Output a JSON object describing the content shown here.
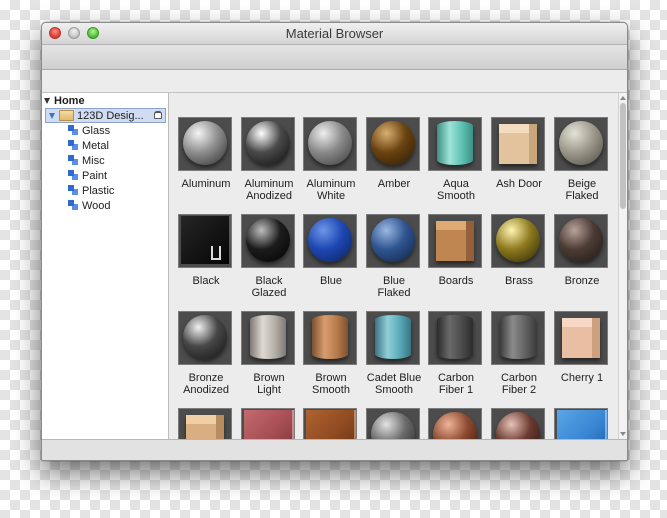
{
  "window": {
    "title": "Material Browser"
  },
  "tree": {
    "home_label": "Home",
    "library_label": "123D Desig...",
    "categories": [
      "Glass",
      "Metal",
      "Misc",
      "Paint",
      "Plastic",
      "Wood"
    ]
  },
  "materials": [
    {
      "label": "Aluminum",
      "shape": "sphere",
      "colors": [
        "#f4f4f4",
        "#8f8f8f",
        "#2e2e2e"
      ]
    },
    {
      "label": "Aluminum\nAnodized",
      "shape": "sphere",
      "colors": [
        "#ffffff",
        "#4a4a4a",
        "#0c0c0c"
      ]
    },
    {
      "label": "Aluminum\nWhite",
      "shape": "sphere",
      "colors": [
        "#eeeeee",
        "#8a8a8a",
        "#3a3a3a"
      ]
    },
    {
      "label": "Amber",
      "shape": "sphere",
      "colors": [
        "#d9b070",
        "#6b4310",
        "#2a1a06"
      ]
    },
    {
      "label": "Aqua\nSmooth",
      "shape": "cylinder",
      "colors": [
        "#9fe3d8",
        "#5cc2b4",
        "#3b8f84"
      ]
    },
    {
      "label": "Ash Door",
      "shape": "cube",
      "colors": [
        "#f4dcbf",
        "#e2c39d",
        "#c9a57a"
      ]
    },
    {
      "label": "Beige\nFlaked",
      "shape": "sphere",
      "colors": [
        "#e5e2d8",
        "#9e998c",
        "#4e4a42"
      ]
    },
    {
      "label": "Black",
      "shape": "chair",
      "colors": [
        "#252525",
        "#141414",
        "#050505"
      ]
    },
    {
      "label": "Black\nGlazed",
      "shape": "sphere",
      "colors": [
        "#bdbdbd",
        "#1c1c1c",
        "#020202"
      ]
    },
    {
      "label": "Blue",
      "shape": "sphere",
      "colors": [
        "#6f96e8",
        "#1d48b3",
        "#0a1f5c"
      ]
    },
    {
      "label": "Blue\nFlaked",
      "shape": "sphere",
      "colors": [
        "#9ab8e2",
        "#2f5591",
        "#0e2142"
      ]
    },
    {
      "label": "Boards",
      "shape": "cube",
      "colors": [
        "#deaa74",
        "#c08651",
        "#93603a"
      ]
    },
    {
      "label": "Brass",
      "shape": "sphere",
      "colors": [
        "#fff4b0",
        "#8d7a1f",
        "#2b2406"
      ]
    },
    {
      "label": "Bronze",
      "shape": "sphere",
      "colors": [
        "#b7a39a",
        "#4c3c35",
        "#1e1613"
      ]
    },
    {
      "label": "Bronze\nAnodized",
      "shape": "sphere",
      "colors": [
        "#f2f2f2",
        "#474747",
        "#121212"
      ]
    },
    {
      "label": "Brown\nLight",
      "shape": "cylinder",
      "colors": [
        "#dedad3",
        "#b3afa7",
        "#7e7a73"
      ]
    },
    {
      "label": "Brown\nSmooth",
      "shape": "cylinder",
      "colors": [
        "#d79d6f",
        "#b67a4b",
        "#7f5131"
      ]
    },
    {
      "label": "Cadet Blue\nSmooth",
      "shape": "cylinder",
      "colors": [
        "#8fcfd9",
        "#58a8b7",
        "#3b7481"
      ]
    },
    {
      "label": "Carbon\nFiber 1",
      "shape": "cylinder",
      "colors": [
        "#6a6a6a",
        "#4a4a4a",
        "#2c2c2c"
      ]
    },
    {
      "label": "Carbon\nFiber 2",
      "shape": "cylinder",
      "colors": [
        "#8a8a8a",
        "#626262",
        "#3d3d3d"
      ]
    },
    {
      "label": "Cherry 1",
      "shape": "cube",
      "colors": [
        "#f6d8c4",
        "#e8bfa3",
        "#cfa07f"
      ]
    },
    {
      "label": "",
      "shape": "cube",
      "colors": [
        "#f1cfa6",
        "#d9ae80",
        "#b98c5e"
      ]
    },
    {
      "label": "",
      "shape": "chair",
      "colors": [
        "#c46a6f",
        "#a44d52",
        "#7a3338"
      ]
    },
    {
      "label": "",
      "shape": "chair",
      "colors": [
        "#b06331",
        "#8e4a21",
        "#652f12"
      ]
    },
    {
      "label": "",
      "shape": "sphere",
      "colors": [
        "#e3e3e3",
        "#6b6b6b",
        "#222222"
      ]
    },
    {
      "label": "",
      "shape": "sphere",
      "colors": [
        "#f0b49a",
        "#8d4a30",
        "#331409"
      ]
    },
    {
      "label": "",
      "shape": "sphere",
      "colors": [
        "#e6c2b8",
        "#6b3a30",
        "#2b120d"
      ]
    },
    {
      "label": "",
      "shape": "chair",
      "colors": [
        "#5aa6e6",
        "#3a86d3",
        "#1e5ea8"
      ]
    }
  ]
}
